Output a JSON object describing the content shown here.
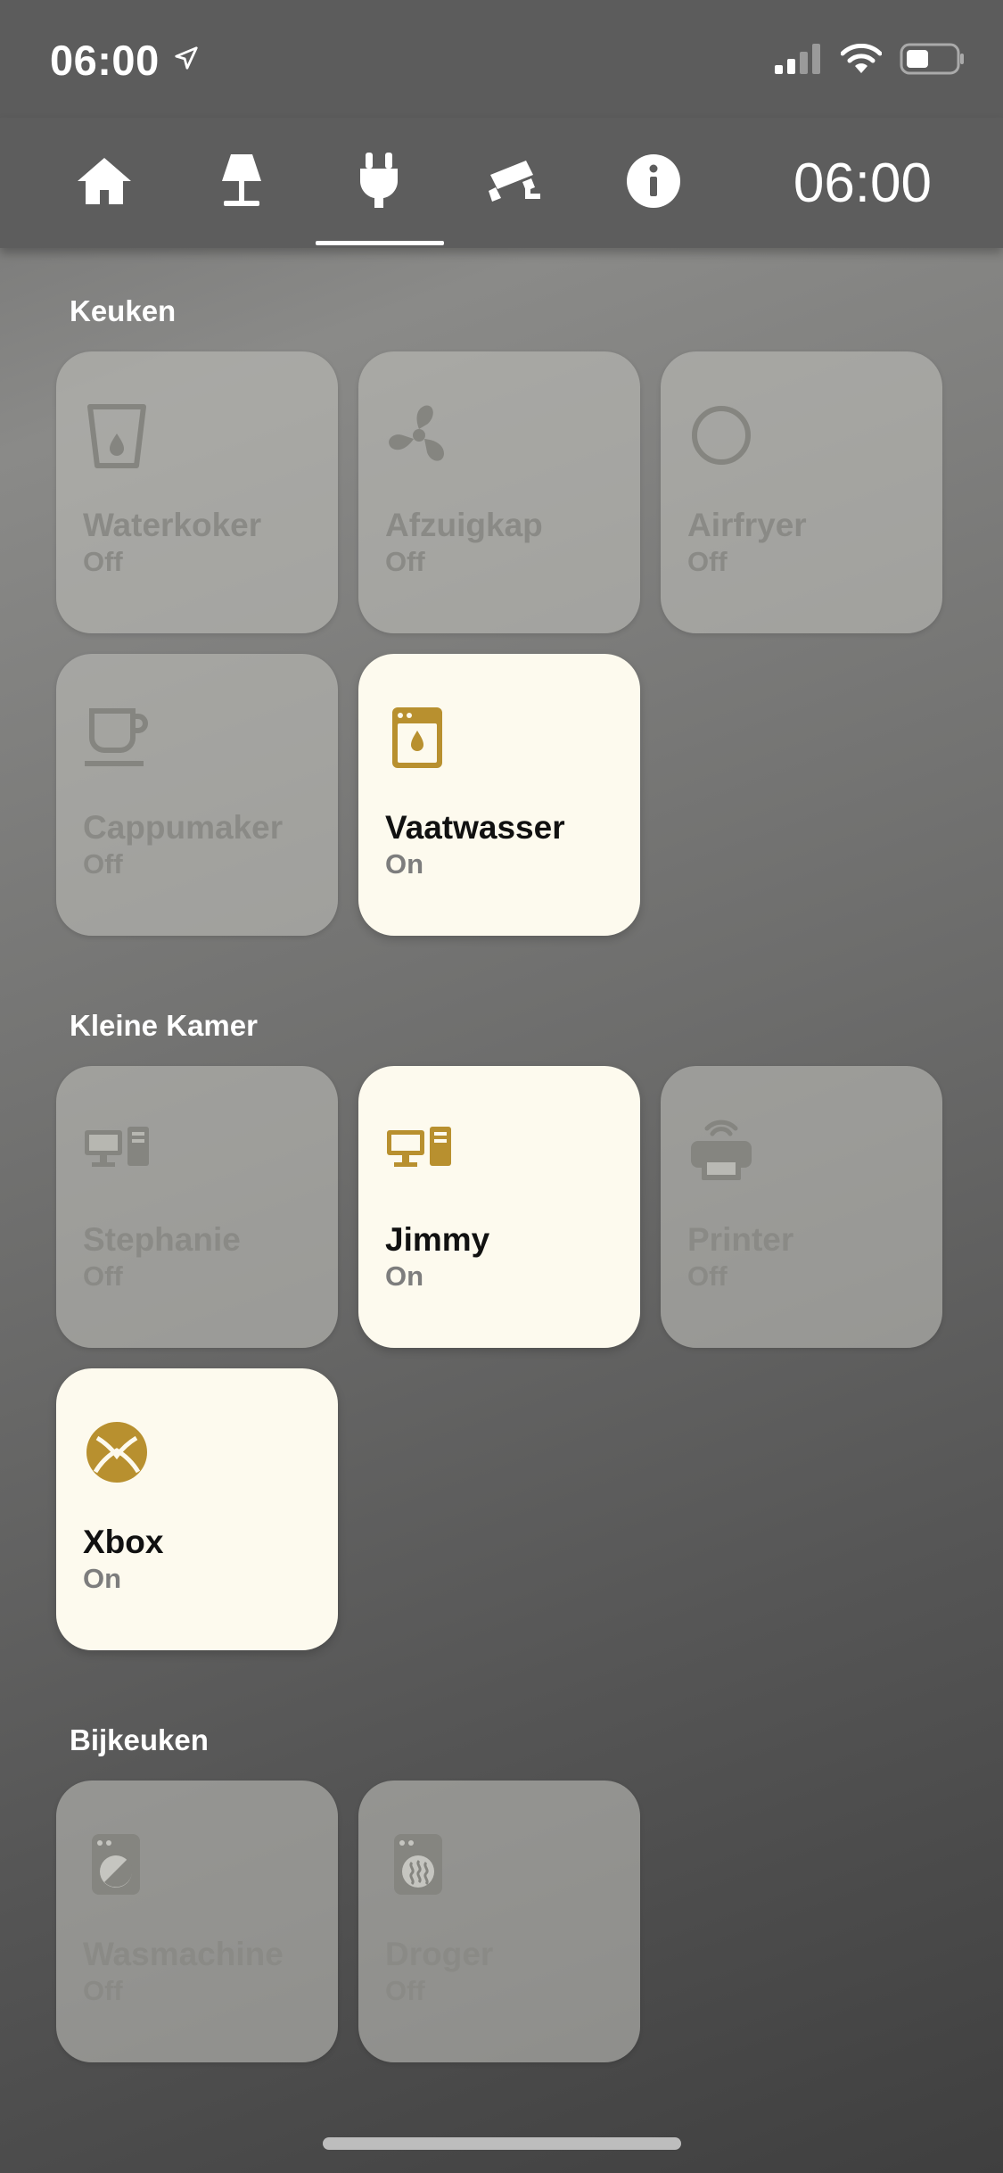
{
  "status_bar": {
    "time": "06:00",
    "signal": "signal-icon",
    "wifi": "wifi-icon",
    "battery": "battery-icon"
  },
  "nav": {
    "tabs": [
      {
        "icon": "home-icon"
      },
      {
        "icon": "lamp-icon"
      },
      {
        "icon": "plug-icon",
        "active": true
      },
      {
        "icon": "camera-icon"
      },
      {
        "icon": "info-icon"
      }
    ],
    "clock": "06:00"
  },
  "sections": [
    {
      "title": "Keuken",
      "devices": [
        {
          "name": "Waterkoker",
          "state": "Off",
          "icon": "kettle-icon"
        },
        {
          "name": "Afzuigkap",
          "state": "Off",
          "icon": "fan-icon"
        },
        {
          "name": "Airfryer",
          "state": "Off",
          "icon": "circle-icon"
        },
        {
          "name": "Cappumaker",
          "state": "Off",
          "icon": "coffee-icon"
        },
        {
          "name": "Vaatwasser",
          "state": "On",
          "icon": "dishwasher-icon"
        }
      ]
    },
    {
      "title": "Kleine Kamer",
      "devices": [
        {
          "name": "Stephanie",
          "state": "Off",
          "icon": "desktop-icon"
        },
        {
          "name": "Jimmy",
          "state": "On",
          "icon": "desktop-icon"
        },
        {
          "name": "Printer",
          "state": "Off",
          "icon": "printer-icon"
        },
        {
          "name": "Xbox",
          "state": "On",
          "icon": "xbox-icon"
        }
      ]
    },
    {
      "title": "Bijkeuken",
      "devices": [
        {
          "name": "Wasmachine",
          "state": "Off",
          "icon": "washing-machine-icon"
        },
        {
          "name": "Droger",
          "state": "Off",
          "icon": "dryer-icon"
        }
      ]
    }
  ],
  "colors": {
    "on_tile": "#fdfaee",
    "accent": "#b8902f",
    "off_icon": "#858580"
  }
}
